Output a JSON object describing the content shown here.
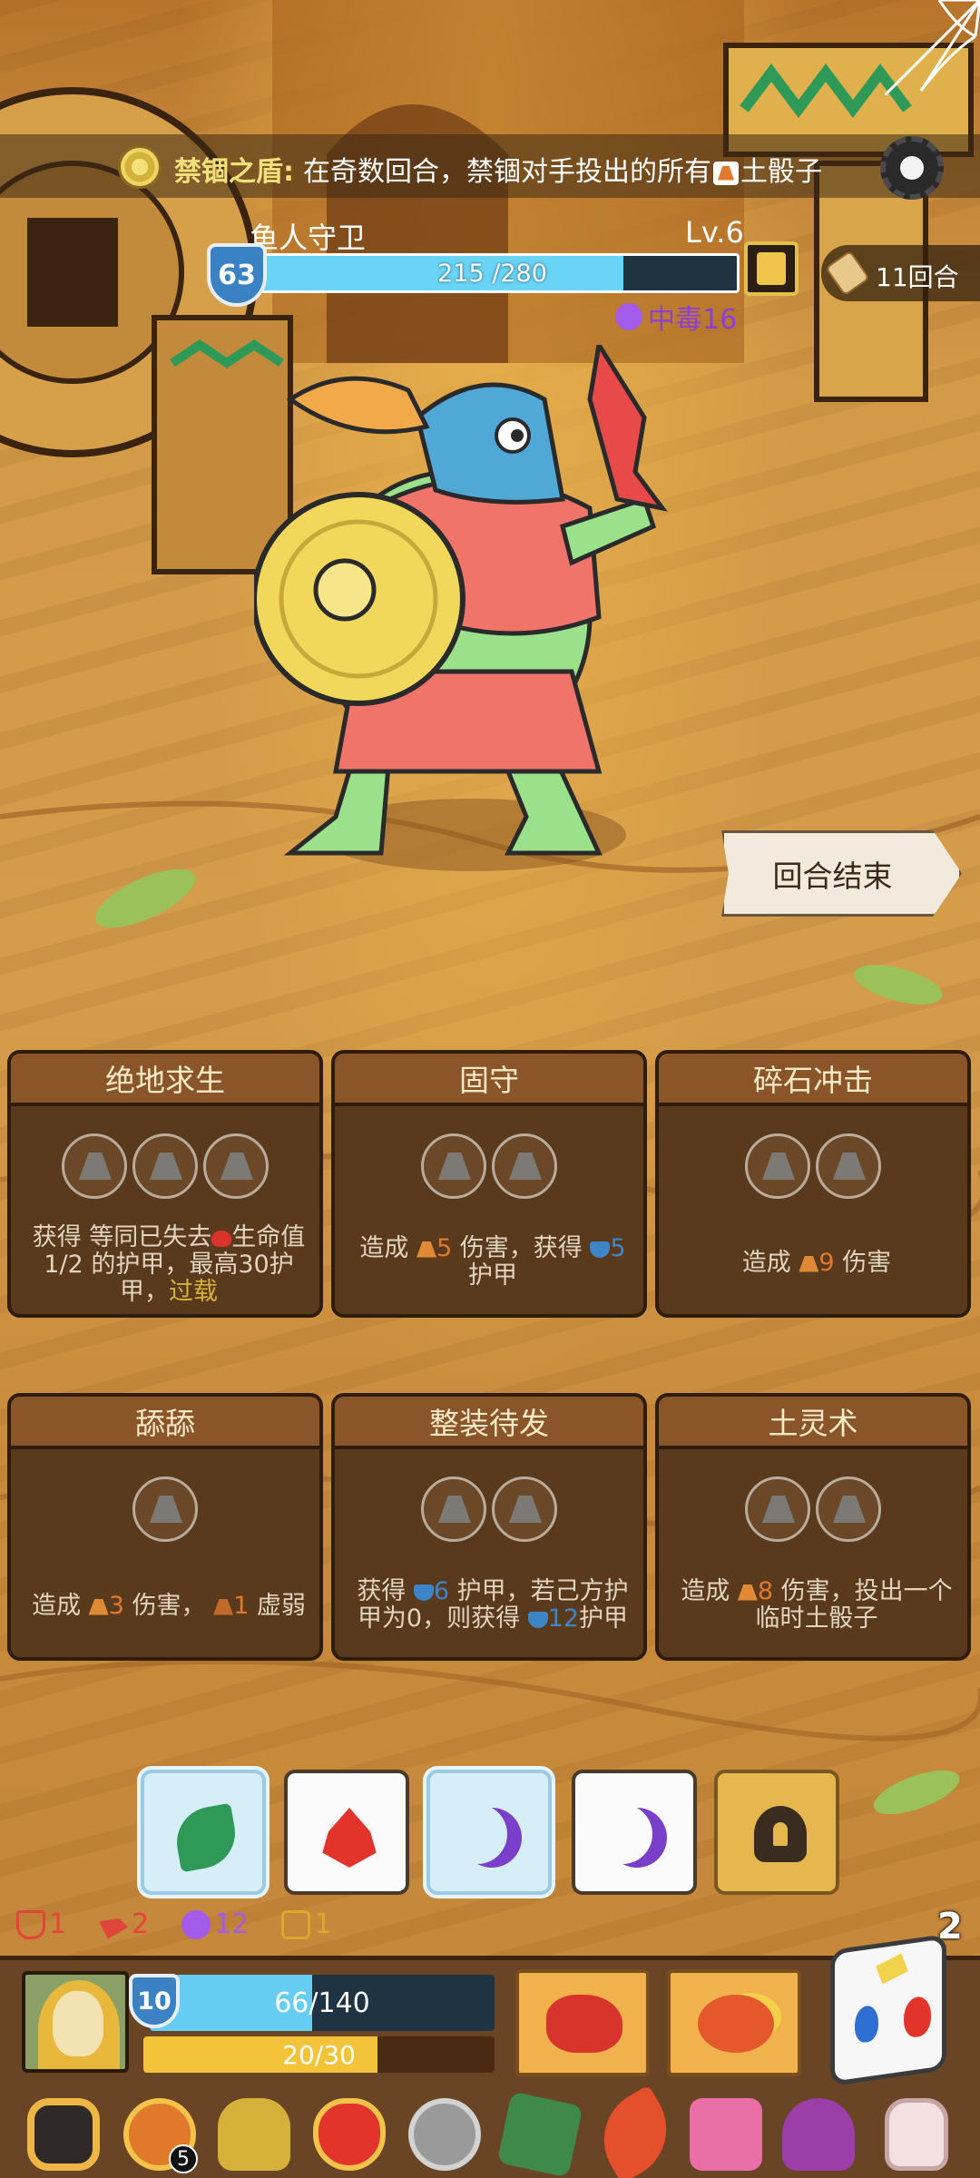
{
  "banner": {
    "title": "禁锢之盾:",
    "description": "在奇数回合，禁锢对手投出的所有",
    "description_tail": "土骰子"
  },
  "enemy": {
    "name": "鱼人守卫",
    "level": "Lv.6",
    "armor": "63",
    "hp_text": "215 /280",
    "hp_fraction": 0.768,
    "poison": "中毒16"
  },
  "round": {
    "label": "11回合"
  },
  "end_turn": {
    "label": "回合结束"
  },
  "cards": [
    {
      "title": "绝地求生",
      "slots": 3,
      "text_a": "获得 等同已失去",
      "text_b": "生命值1/2 的护甲，最高30护甲，",
      "text_c": "过载"
    },
    {
      "title": "固守",
      "slots": 2,
      "text_a": "造成 ",
      "num1": "5",
      "text_b": " 伤害，获得 ",
      "num2": "5",
      "text_c": "护甲"
    },
    {
      "title": "碎石冲击",
      "slots": 2,
      "text_a": "造成 ",
      "num1": "9",
      "text_b": " 伤害"
    },
    {
      "title": "舔舔",
      "slots": 1,
      "text_a": "造成 ",
      "num1": "3",
      "text_b": " 伤害， ",
      "num2": "1",
      "text_c": " 虚弱"
    },
    {
      "title": "整装待发",
      "slots": 2,
      "text_a": "获得 ",
      "num1": "6",
      "text_b": " 护甲，若己方护甲为0，则获得 ",
      "num2": "12",
      "text_c": "护甲"
    },
    {
      "title": "土灵术",
      "slots": 2,
      "text_a": "造成 ",
      "num1": "8",
      "text_b": " 伤害，投出一个临时土骰子"
    }
  ],
  "dice": [
    {
      "face": "leaf",
      "frozen": true
    },
    {
      "face": "fire",
      "frozen": false
    },
    {
      "face": "moon",
      "frozen": true
    },
    {
      "face": "moon",
      "frozen": false
    },
    {
      "face": "lock",
      "frozen": false
    }
  ],
  "statuses": [
    {
      "icon": "shield-broken-icon",
      "value": "1"
    },
    {
      "icon": "burn-icon",
      "value": "2"
    },
    {
      "icon": "poison-icon",
      "value": "12"
    },
    {
      "icon": "lock-icon",
      "value": "1"
    }
  ],
  "dice_remaining": "2",
  "player": {
    "armor": "10",
    "hp_text": "66/140",
    "hp_fraction": 0.471,
    "energy_text": "20/30",
    "energy_fraction": 0.667
  },
  "relics": [
    {
      "icon": "gear-relic-icon"
    },
    {
      "icon": "demon-mask-relic-icon",
      "badge": "5"
    },
    {
      "icon": "helmet-relic-icon"
    },
    {
      "icon": "heart-amulet-relic-icon"
    },
    {
      "icon": "coin-relic-icon"
    },
    {
      "icon": "green-tome-relic-icon"
    },
    {
      "icon": "feather-relic-icon"
    },
    {
      "icon": "heart-box-relic-icon"
    },
    {
      "icon": "cursed-heart-relic-icon"
    },
    {
      "icon": "potion-jar-relic-icon"
    }
  ],
  "colors": {
    "hp_blue": "#6ad4f6",
    "energy_yellow": "#f3c33a",
    "poison_purple": "#a45bea",
    "earth_orange": "#e0782e",
    "armor_blue": "#3e85c7"
  }
}
